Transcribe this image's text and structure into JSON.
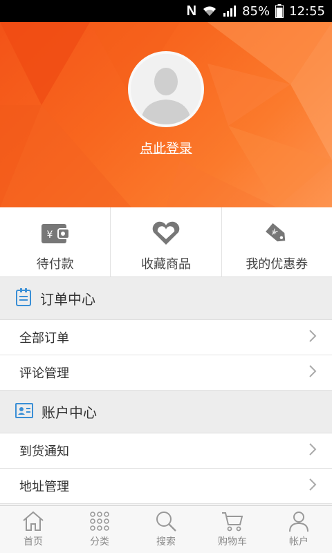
{
  "status_bar": {
    "n_icon": "N",
    "wifi_icon": "wifi-icon",
    "signal_icon": "signal-icon",
    "battery": "85%",
    "time": "12:55"
  },
  "profile": {
    "login_text": "点此登录",
    "avatar_icon": "default-avatar-icon"
  },
  "quick_actions": [
    {
      "label": "待付款",
      "icon": "wallet-icon"
    },
    {
      "label": "收藏商品",
      "icon": "heart-icon"
    },
    {
      "label": "我的优惠券",
      "icon": "coupon-tag-icon"
    }
  ],
  "order_section": {
    "title": "订单中心",
    "icon": "clipboard-icon",
    "items": [
      {
        "label": "全部订单"
      },
      {
        "label": "评论管理"
      }
    ]
  },
  "account_section": {
    "title": "账户中心",
    "icon": "id-card-icon",
    "items": [
      {
        "label": "到货通知"
      },
      {
        "label": "地址管理"
      }
    ]
  },
  "tabs": [
    {
      "label": "首页",
      "icon": "home-icon"
    },
    {
      "label": "分类",
      "icon": "grid-dots-icon"
    },
    {
      "label": "搜索",
      "icon": "search-icon"
    },
    {
      "label": "购物车",
      "icon": "cart-icon"
    },
    {
      "label": "帐户",
      "icon": "user-icon"
    }
  ],
  "colors": {
    "accent": "#f7621c",
    "icon_blue": "#3a8fd6",
    "icon_gray": "#777777"
  }
}
